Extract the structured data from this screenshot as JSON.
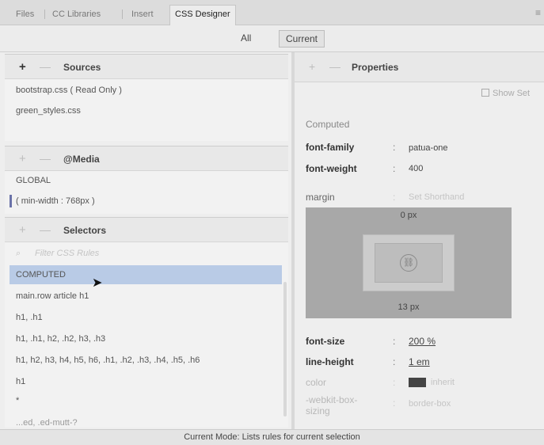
{
  "tabs": [
    {
      "label": "Files"
    },
    {
      "label": "CC Libraries"
    },
    {
      "label": "Insert"
    },
    {
      "label": "CSS Designer",
      "active": true
    }
  ],
  "panel_menu_icon": "hamburger-menu-icon",
  "mode_toggle": {
    "all_label": "All",
    "current_label": "Current",
    "selected": "Current"
  },
  "sources": {
    "title": "Sources",
    "items": [
      "bootstrap.css  ( Read Only )",
      "green_styles.css"
    ]
  },
  "media": {
    "title": "@Media",
    "items": [
      "GLOBAL",
      "( min-width : 768px )"
    ]
  },
  "selectors": {
    "title": "Selectors",
    "filter_placeholder": "Filter CSS Rules",
    "items": [
      "COMPUTED",
      "main.row article h1",
      "h1, .h1",
      "h1, .h1, h2, .h2, h3, .h3",
      "h1, h2, h3, h4, h5, h6, .h1, .h2, .h3, .h4, .h5, .h6",
      "h1",
      "*",
      "...ed, .ed-mutt-?"
    ],
    "selected_index": 0
  },
  "properties": {
    "title": "Properties",
    "show_set_label": "Show Set",
    "computed_label": "Computed",
    "font_family": {
      "name": "font-family",
      "value": "patua-one"
    },
    "font_weight": {
      "name": "font-weight",
      "value": "400"
    },
    "margin": {
      "name": "margin",
      "value": "Set Shorthand"
    },
    "margin_top": "0 px",
    "margin_bottom": "13 px",
    "font_size": {
      "name": "font-size",
      "value": "200 %"
    },
    "line_height": {
      "name": "line-height",
      "value": "1 em"
    },
    "color": {
      "name": "color",
      "value": "inherit",
      "swatch": "#444444"
    },
    "text_decoration": {
      "name": "-webkit-box-sizing",
      "value": "border-box"
    }
  },
  "status_text": "Current Mode: Lists rules for current selection",
  "colors": {
    "selection": "#b9cbe6",
    "media_bar": "#6a72a8",
    "box_model": "#a8a8a8"
  }
}
